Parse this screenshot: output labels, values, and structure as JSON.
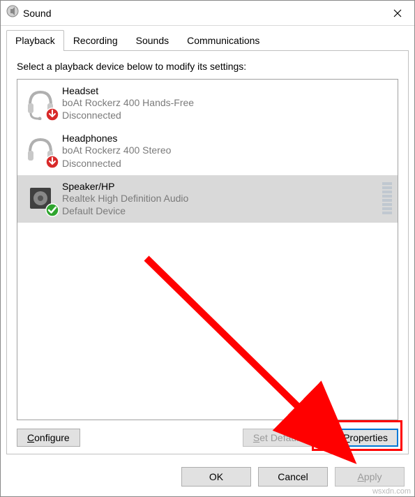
{
  "window": {
    "title": "Sound"
  },
  "tabs": [
    "Playback",
    "Recording",
    "Sounds",
    "Communications"
  ],
  "activeTab": 0,
  "panel": {
    "info": "Select a playback device below to modify its settings:"
  },
  "devices": [
    {
      "name": "Headset",
      "sub1": "boAt Rockerz 400 Hands-Free",
      "sub2": "Disconnected"
    },
    {
      "name": "Headphones",
      "sub1": "boAt Rockerz 400 Stereo",
      "sub2": "Disconnected"
    },
    {
      "name": "Speaker/HP",
      "sub1": "Realtek High Definition Audio",
      "sub2": "Default Device"
    }
  ],
  "selectedDevice": 2,
  "buttons": {
    "configure": "Configure",
    "setdefault": "Set Default",
    "properties": "Properties",
    "ok": "OK",
    "cancel": "Cancel",
    "apply": "Apply"
  },
  "watermark": "wsxdn.com"
}
